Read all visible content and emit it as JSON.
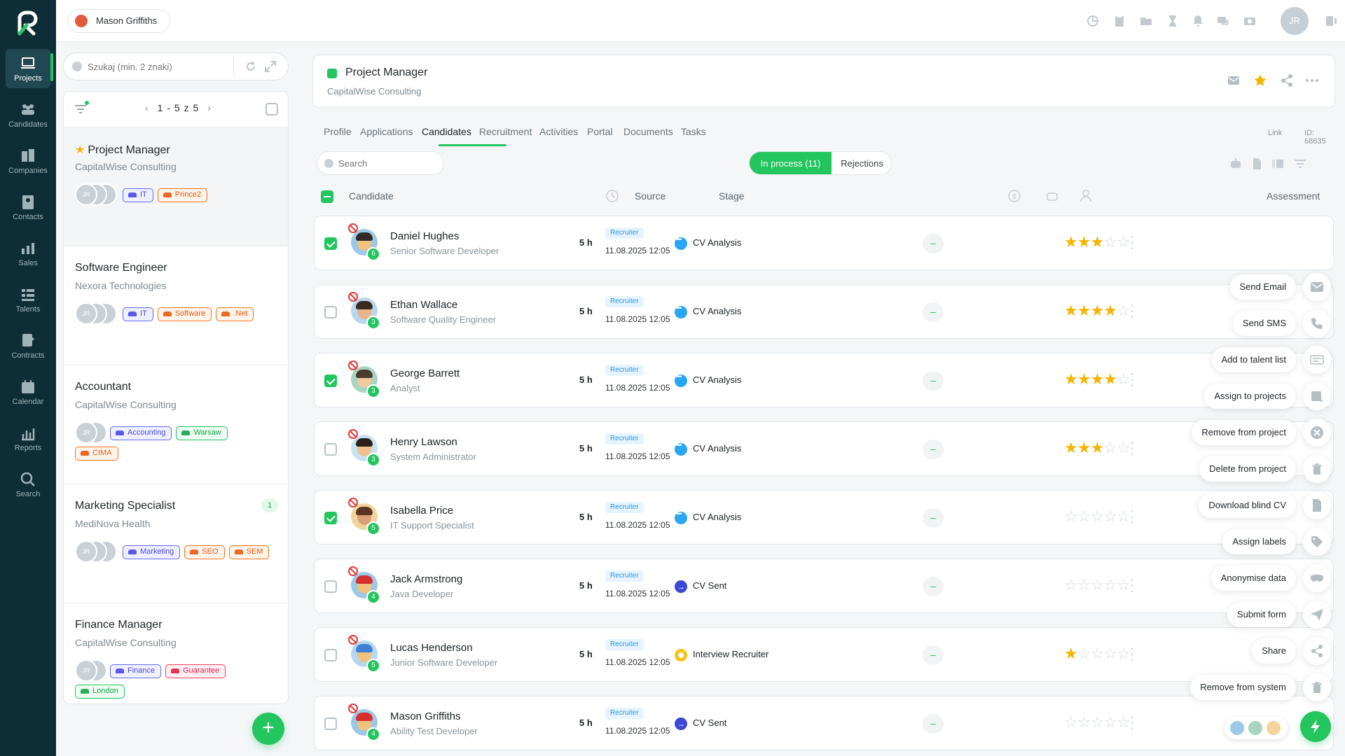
{
  "nav": {
    "items": [
      {
        "label": "Projects",
        "icon": "laptop-icon"
      },
      {
        "label": "Candidates",
        "icon": "people-icon"
      },
      {
        "label": "Companies",
        "icon": "building-icon"
      },
      {
        "label": "Contacts",
        "icon": "contact-card-icon"
      },
      {
        "label": "Sales",
        "icon": "sales-chart-icon"
      },
      {
        "label": "Talents",
        "icon": "list-icon"
      },
      {
        "label": "Contracts",
        "icon": "contract-icon"
      },
      {
        "label": "Calendar",
        "icon": "calendar-icon"
      },
      {
        "label": "Reports",
        "icon": "bar-chart-icon"
      },
      {
        "label": "Search",
        "icon": "search-icon"
      }
    ],
    "active": "Projects"
  },
  "topbar": {
    "user_name": "Mason Griffiths",
    "avatar_initials": "JR"
  },
  "left_panel": {
    "search_placeholder": "Szukaj (min. 2 znaki)",
    "pager": "1 - 5 z 5",
    "projects": [
      {
        "title": "Project Manager",
        "company": "CapitalWise Consulting",
        "starred": true,
        "avatar": "JR",
        "tags": [
          {
            "label": "IT",
            "color": "blue"
          },
          {
            "label": "Prince2",
            "color": "orange"
          }
        ]
      },
      {
        "title": "Software Engineer",
        "company": "Nexora Technologies",
        "avatar": "JR",
        "tags": [
          {
            "label": "IT",
            "color": "blue"
          },
          {
            "label": "Software",
            "color": "orange"
          },
          {
            "label": ".Net",
            "color": "orange"
          }
        ]
      },
      {
        "title": "Accountant",
        "company": "CapitalWise Consulting",
        "avatar": "JR",
        "tags": [
          {
            "label": "Accounting",
            "color": "blue"
          },
          {
            "label": "Warsaw",
            "color": "green"
          },
          {
            "label": "CIMA",
            "color": "orange"
          }
        ]
      },
      {
        "title": "Marketing Specialist",
        "company": "MediNova Health",
        "badge": "1",
        "avatar": "JR",
        "tags": [
          {
            "label": "Marketing",
            "color": "blue"
          },
          {
            "label": "SEO",
            "color": "orange"
          },
          {
            "label": "SEM",
            "color": "orange"
          }
        ]
      },
      {
        "title": "Finance Manager",
        "company": "CapitalWise Consulting",
        "avatar": "JR",
        "tags": [
          {
            "label": "Finance",
            "color": "blue"
          },
          {
            "label": "Guarantee",
            "color": "red"
          },
          {
            "label": "London",
            "color": "green"
          }
        ]
      }
    ]
  },
  "project": {
    "title": "Project Manager",
    "company": "CapitalWise Consulting",
    "link_label": "Link",
    "id_label": "ID: 68635"
  },
  "tabs": [
    "Profile",
    "Applications",
    "Candidates",
    "Recruitment",
    "Activities",
    "Portal",
    "Documents",
    "Tasks"
  ],
  "active_tab": "Candidates",
  "toolbar": {
    "search_placeholder": "Search",
    "in_process": "In process (11)",
    "rejections": "Rejections"
  },
  "table": {
    "headers": {
      "candidate": "Candidate",
      "source": "Source",
      "stage": "Stage",
      "assessment": "Assessment"
    },
    "rows": [
      {
        "name": "Daniel Hughes",
        "role": "Senior Software Developer",
        "count": "6",
        "checked": true,
        "time": "5 h",
        "source": "Recruiter",
        "date": "11.08.2025 12:05",
        "stage": "CV Analysis",
        "stage_type": "dots",
        "rating": 3,
        "dash": "–",
        "skin": "#f1c27d",
        "hair": "#2f2a26",
        "bg": "#9cc9e8"
      },
      {
        "name": "Ethan Wallace",
        "role": "Software Quality Engineer",
        "count": "3",
        "checked": false,
        "time": "5 h",
        "source": "Recruiter",
        "date": "11.08.2025 12:05",
        "stage": "CV Analysis",
        "stage_type": "dots",
        "rating": 4,
        "dash": "–",
        "skin": "#e8b48a",
        "hair": "#3b2a20",
        "bg": "#b9d7ee"
      },
      {
        "name": "George Barrett",
        "role": "Analyst",
        "count": "3",
        "checked": true,
        "time": "5 h",
        "source": "Recruiter",
        "date": "11.08.2025 12:05",
        "stage": "CV Analysis",
        "stage_type": "dots",
        "rating": 4,
        "dash": "–",
        "skin": "#f0c9a0",
        "hair": "#4a3b2e",
        "bg": "#a8d5c2"
      },
      {
        "name": "Henry Lawson",
        "role": "System Administrator",
        "count": "3",
        "checked": false,
        "time": "5 h",
        "source": "Recruiter",
        "date": "11.08.2025 12:05",
        "stage": "CV Analysis",
        "stage_type": "dots",
        "rating": 3,
        "dash": "–",
        "skin": "#efc08f",
        "hair": "#2b1f18",
        "bg": "#c9e2f2"
      },
      {
        "name": "Isabella Price",
        "role": "IT Support Specialist",
        "count": "5",
        "checked": true,
        "time": "5 h",
        "source": "Recruiter",
        "date": "11.08.2025 12:05",
        "stage": "CV Analysis",
        "stage_type": "dots",
        "rating": 0,
        "dash": "–",
        "skin": "#d9a07a",
        "hair": "#5a3524",
        "bg": "#f2d49b"
      },
      {
        "name": "Jack Armstrong",
        "role": "Java Developer",
        "count": "4",
        "checked": false,
        "time": "5 h",
        "source": "Recruiter",
        "date": "11.08.2025 12:05",
        "stage": "CV Sent",
        "stage_type": "arrow",
        "rating": 0,
        "dash": "–",
        "skin": "#f1c27d",
        "hair": "#d62f2f",
        "bg": "#9cc9e8"
      },
      {
        "name": "Lucas Henderson",
        "role": "Junior Software Developer",
        "count": "5",
        "checked": false,
        "time": "5 h",
        "source": "Recruiter",
        "date": "11.08.2025 12:05",
        "stage": "Interview Recruiter",
        "stage_type": "ring",
        "rating": 1,
        "dash": "–",
        "skin": "#f1c27d",
        "hair": "#3f7fd6",
        "bg": "#b5d8f0"
      },
      {
        "name": "Mason Griffiths",
        "role": "Ability Test Developer",
        "count": "4",
        "checked": false,
        "time": "5 h",
        "source": "Recruiter",
        "date": "11.08.2025 12:05",
        "stage": "CV Sent",
        "stage_type": "arrow",
        "rating": 0,
        "dash": "–",
        "skin": "#f1c27d",
        "hair": "#d62f2f",
        "bg": "#9cc9e8"
      }
    ]
  },
  "action_menu": [
    {
      "label": "Send Email",
      "icon": "mail-icon"
    },
    {
      "label": "Send SMS",
      "icon": "phone-icon"
    },
    {
      "label": "Add to talent list",
      "icon": "talent-list-icon"
    },
    {
      "label": "Assign to projects",
      "icon": "assign-icon"
    },
    {
      "label": "Remove from project",
      "icon": "close-circle-icon"
    },
    {
      "label": "Delete from project",
      "icon": "trash-icon"
    },
    {
      "label": "Download blind CV",
      "icon": "document-icon"
    },
    {
      "label": "Assign labels",
      "icon": "tag-icon"
    },
    {
      "label": "Anonymise data",
      "icon": "mask-icon"
    },
    {
      "label": "Submit form",
      "icon": "send-icon"
    },
    {
      "label": "Share",
      "icon": "share-icon"
    },
    {
      "label": "Remove from system",
      "icon": "trash-icon"
    }
  ],
  "colors": {
    "accent": "#22c55e",
    "sidebar": "#0e2d36",
    "star": "#f5b400"
  }
}
